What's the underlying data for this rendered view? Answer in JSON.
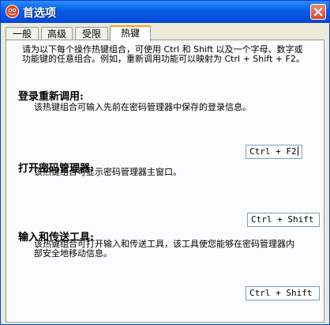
{
  "window": {
    "title": "首选项"
  },
  "tabs": [
    {
      "label": "一般"
    },
    {
      "label": "高级"
    },
    {
      "label": "受限"
    },
    {
      "label": "热键"
    }
  ],
  "intro": "请为以下每个操作热键组合，可使用 Ctrl 和 Shift 以及一个字母、数字或功能键的任意组合。例如，重新调用功能可以映射为 Ctrl + Shift + F2。",
  "sections": [
    {
      "title": "登录重新调用:",
      "description": "该热键组合可输入先前在密码管理器中保存的登录信息。",
      "hotkey": "Ctrl + F2"
    },
    {
      "title": "打开密码管理器:",
      "description": "该热键组合可显示密码管理器主窗口。",
      "hotkey": "Ctrl + Shift"
    },
    {
      "title": "输入和传送工具:",
      "description": "该热键组合可打开输入和传送工具，该工具使您能够在密码管理器内部安全地移动信息。",
      "hotkey": "Ctrl + Shift"
    }
  ],
  "colors": {
    "title_bar": "#0a5ce8",
    "active_tab_accent": "#f9a31b",
    "close_button": "#d8462b"
  }
}
